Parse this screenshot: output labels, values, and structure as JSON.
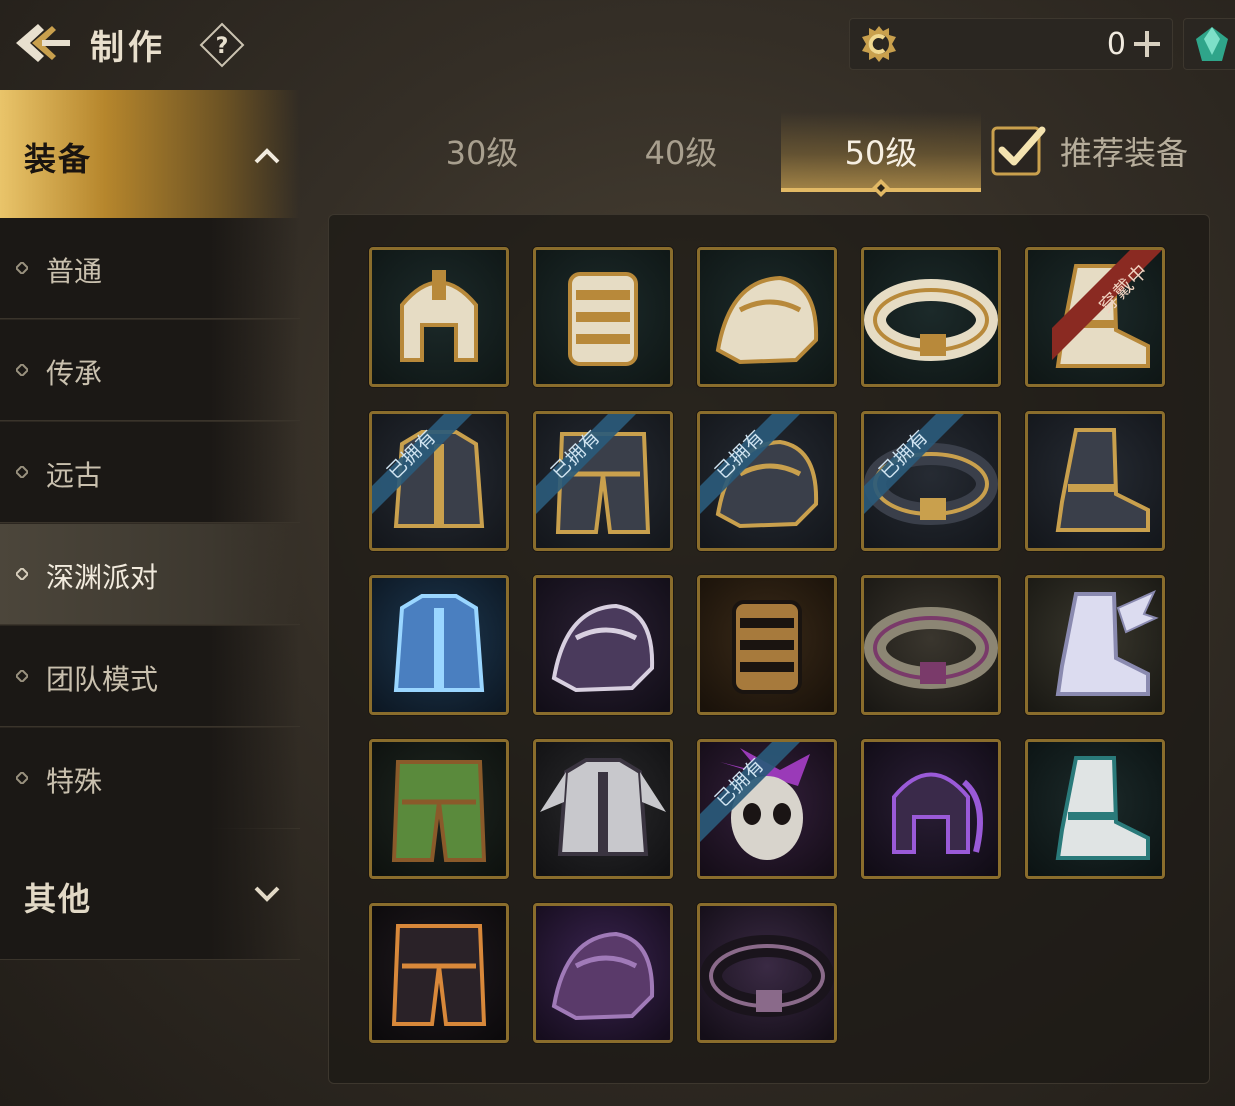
{
  "header": {
    "title": "制作",
    "help_label": "?",
    "currency": {
      "icon": "gold-coin-icon",
      "value": "0"
    },
    "gem": {
      "icon": "gem-icon"
    }
  },
  "sidebar": {
    "active_category": {
      "label": "装备",
      "expanded": true
    },
    "items": [
      {
        "label": "普通",
        "selected": false
      },
      {
        "label": "传承",
        "selected": false
      },
      {
        "label": "远古",
        "selected": false
      },
      {
        "label": "深渊派对",
        "selected": true
      },
      {
        "label": "团队模式",
        "selected": false
      },
      {
        "label": "特殊",
        "selected": false
      }
    ],
    "other_category": {
      "label": "其他",
      "expanded": false
    }
  },
  "tabs": [
    {
      "label": "30级",
      "active": false
    },
    {
      "label": "40级",
      "active": false
    },
    {
      "label": "50级",
      "active": true
    }
  ],
  "recommend": {
    "label": "推荐装备",
    "checked": true
  },
  "ribbons": {
    "owned": "已拥有",
    "wearing": "穿戴中"
  },
  "items": [
    {
      "name": "helmet",
      "icon": "helmet-icon",
      "theme": "gold-white",
      "badge": null
    },
    {
      "name": "gauntlet",
      "icon": "gauntlet-icon",
      "theme": "gold-white",
      "badge": null
    },
    {
      "name": "shoulder",
      "icon": "shoulder-icon",
      "theme": "gold-white",
      "badge": null
    },
    {
      "name": "belt",
      "icon": "belt-icon",
      "theme": "gold-white",
      "badge": null
    },
    {
      "name": "boots",
      "icon": "boots-icon",
      "theme": "gold-white",
      "badge": "wearing"
    },
    {
      "name": "chest-armor",
      "icon": "chest-armor-icon",
      "theme": "dark-navy",
      "badge": "owned"
    },
    {
      "name": "leg-armor",
      "icon": "leg-armor-icon",
      "theme": "dark-navy",
      "badge": "owned"
    },
    {
      "name": "shoulder",
      "icon": "shoulder-icon",
      "theme": "dark-navy",
      "badge": "owned"
    },
    {
      "name": "belt",
      "icon": "belt-icon",
      "theme": "dark-navy",
      "badge": "owned"
    },
    {
      "name": "boots",
      "icon": "boots-icon",
      "theme": "dark-navy",
      "badge": null
    },
    {
      "name": "chest-armor",
      "icon": "chest-armor-icon",
      "theme": "spirit-blue",
      "badge": null
    },
    {
      "name": "shoulder",
      "icon": "shoulder-icon",
      "theme": "shadow-purple",
      "badge": null
    },
    {
      "name": "gauntlet",
      "icon": "gauntlet-icon",
      "theme": "bronze",
      "badge": null
    },
    {
      "name": "belt",
      "icon": "belt-icon",
      "theme": "stone-purple",
      "badge": null
    },
    {
      "name": "boots",
      "icon": "winged-boots-icon",
      "theme": "white-wing",
      "badge": null
    },
    {
      "name": "leg-armor",
      "icon": "leg-armor-icon",
      "theme": "forest-green",
      "badge": null
    },
    {
      "name": "chest-armor",
      "icon": "winged-chest-icon",
      "theme": "silver-wing",
      "badge": null
    },
    {
      "name": "mask",
      "icon": "skull-mask-icon",
      "theme": "purple-skull",
      "badge": "owned"
    },
    {
      "name": "helmet",
      "icon": "horned-helmet-icon",
      "theme": "void-purple",
      "badge": null
    },
    {
      "name": "boots",
      "icon": "sneaker-icon",
      "theme": "teal-white",
      "badge": null
    },
    {
      "name": "leg-armor",
      "icon": "leg-armor-icon",
      "theme": "abyss-orange",
      "badge": null
    },
    {
      "name": "shoulder",
      "icon": "dragon-shoulder-icon",
      "theme": "abyss-purple",
      "badge": null
    },
    {
      "name": "belt",
      "icon": "abyss-belt-icon",
      "theme": "abyss-dark",
      "badge": null
    }
  ],
  "colors": {
    "gold_border": "#8a6d2c",
    "accent_gold": "#e2b965",
    "owned_ribbon": "#2a5a7a",
    "wearing_ribbon": "#8a2a22"
  }
}
